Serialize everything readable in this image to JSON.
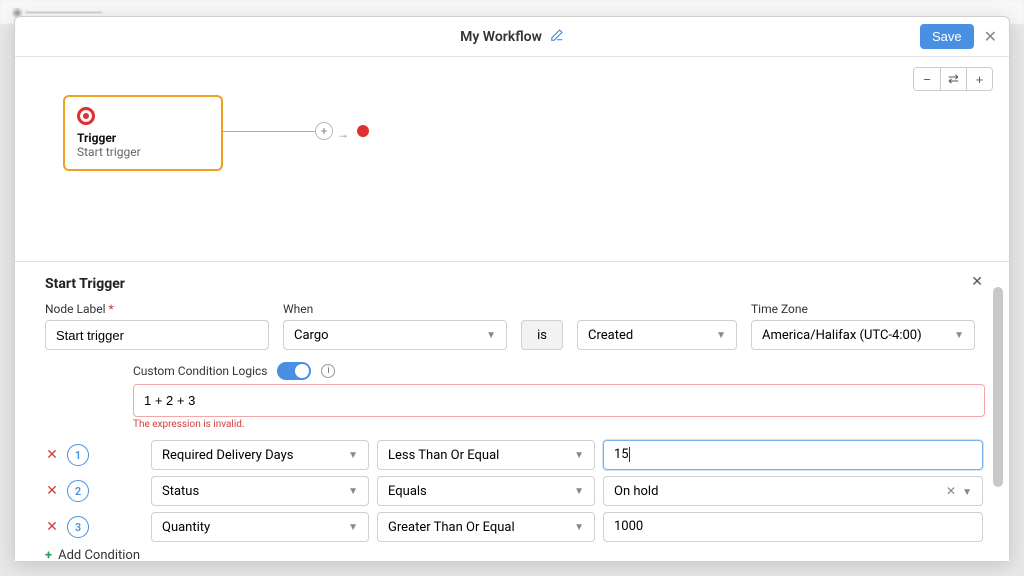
{
  "modal": {
    "title": "My Workflow",
    "save_label": "Save"
  },
  "canvas": {
    "node": {
      "title": "Trigger",
      "subtitle": "Start trigger"
    },
    "zoom_out": "−",
    "fit": "⇄",
    "zoom_in": "+"
  },
  "panel": {
    "title": "Start Trigger",
    "labels": {
      "node_label": "Node Label",
      "when": "When",
      "timezone": "Time Zone",
      "ccl": "Custom Condition Logics"
    },
    "values": {
      "node_label": "Start trigger",
      "when": "Cargo",
      "is": "is",
      "event": "Created",
      "timezone": "America/Halifax (UTC-4:00)",
      "expression": "1 + 2 + 3"
    },
    "expr_error": "The expression is invalid.",
    "conditions": [
      {
        "num": "1",
        "field": "Required Delivery Days",
        "op": "Less Than Or Equal",
        "value": "15",
        "focused": true,
        "type": "text"
      },
      {
        "num": "2",
        "field": "Status",
        "op": "Equals",
        "value": "On hold",
        "type": "select"
      },
      {
        "num": "3",
        "field": "Quantity",
        "op": "Greater Than Or Equal",
        "value": "1000",
        "type": "text"
      }
    ],
    "add_condition": "Add Condition"
  }
}
